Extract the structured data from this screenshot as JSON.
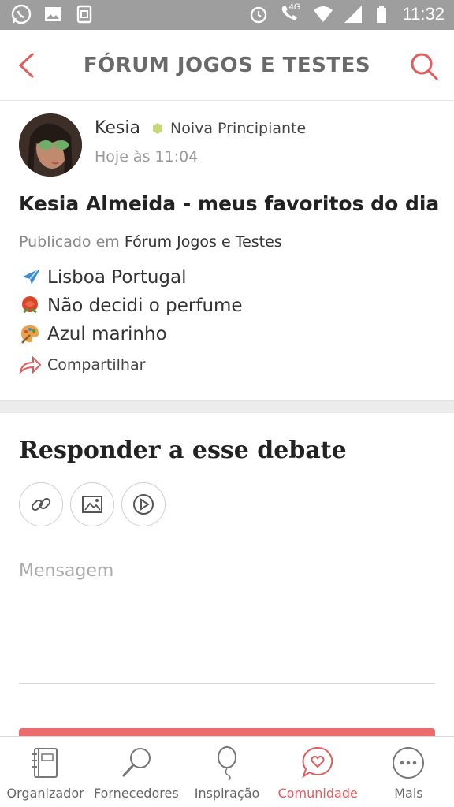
{
  "status_bar": {
    "time": "11:32",
    "network": "4G",
    "left_icons": [
      "whatsapp-icon",
      "gallery-icon",
      "sim-icon"
    ],
    "right_icons": [
      "alarm-icon",
      "call-4g-icon",
      "wifi-icon",
      "signal-icon",
      "battery-icon"
    ]
  },
  "header": {
    "title": "FÓRUM JOGOS E TESTES",
    "back_icon": "chevron-left-icon",
    "search_icon": "search-icon",
    "accent": "#e25c5c"
  },
  "post": {
    "author": "Kesia",
    "rank": "Noiva Principiante",
    "rank_color": "#c6d77a",
    "time": "Hoje às 11:04",
    "title": "Kesia Almeida - meus favoritos do dia c",
    "published_prefix": "Publicado em",
    "forum": "Fórum Jogos e Testes",
    "lines": [
      {
        "icon": "airplane-icon",
        "text": "Lisboa Portugal"
      },
      {
        "icon": "rose-icon",
        "text": "Não decidi o perfume"
      },
      {
        "icon": "palette-icon",
        "text": "Azul marinho"
      }
    ],
    "share_label": "Compartilhar"
  },
  "reply": {
    "title": "Responder a esse debate",
    "tools": [
      "link-icon",
      "image-icon",
      "video-icon"
    ],
    "message_placeholder": "Mensagem"
  },
  "tabbar": {
    "items": [
      {
        "icon": "planner-icon",
        "label": "Organizador"
      },
      {
        "icon": "magnifier-icon",
        "label": "Fornecedores"
      },
      {
        "icon": "balloon-icon",
        "label": "Inspiração"
      },
      {
        "icon": "chat-heart-icon",
        "label": "Comunidade",
        "active": true
      },
      {
        "icon": "more-icon",
        "label": "Mais"
      }
    ],
    "active_color": "#e25c5c"
  }
}
